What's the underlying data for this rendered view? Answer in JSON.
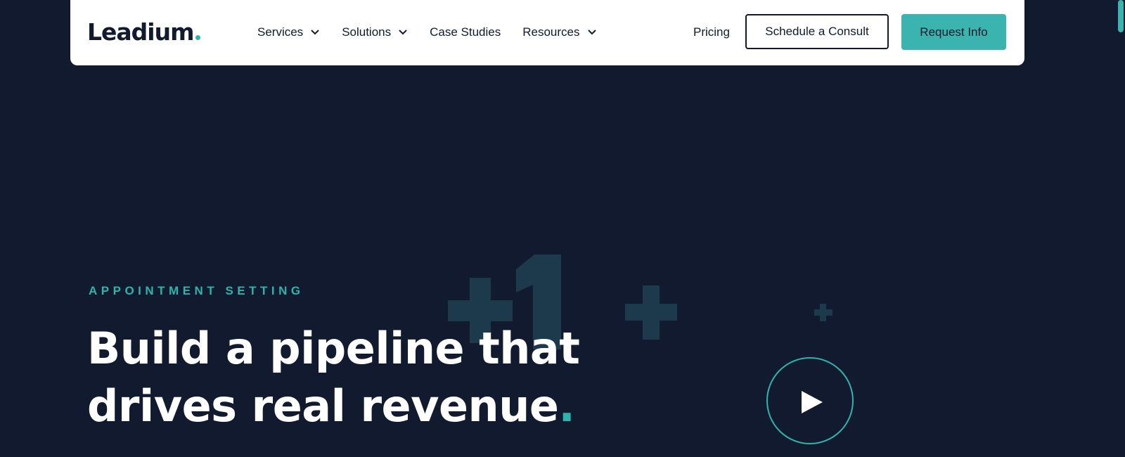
{
  "brand": {
    "logo_text": "Leadium",
    "accent_color": "#2fb3ad",
    "background_color": "#111a2e"
  },
  "nav": {
    "items": [
      {
        "label": "Services",
        "has_dropdown": true,
        "icon": "chevron-down-icon"
      },
      {
        "label": "Solutions",
        "has_dropdown": true,
        "icon": "chevron-down-icon"
      },
      {
        "label": "Case Studies",
        "has_dropdown": false
      },
      {
        "label": "Resources",
        "has_dropdown": true,
        "icon": "chevron-down-icon"
      }
    ],
    "pricing_label": "Pricing",
    "consult_button_label": "Schedule a Consult",
    "request_button_label": "Request Info"
  },
  "hero": {
    "eyebrow": "APPOINTMENT SETTING",
    "headline_line1": "Build a pipeline that",
    "headline_line2": "drives real revenue",
    "headline_end": ".",
    "decor_text": "+1",
    "play_icon": "play-icon"
  }
}
